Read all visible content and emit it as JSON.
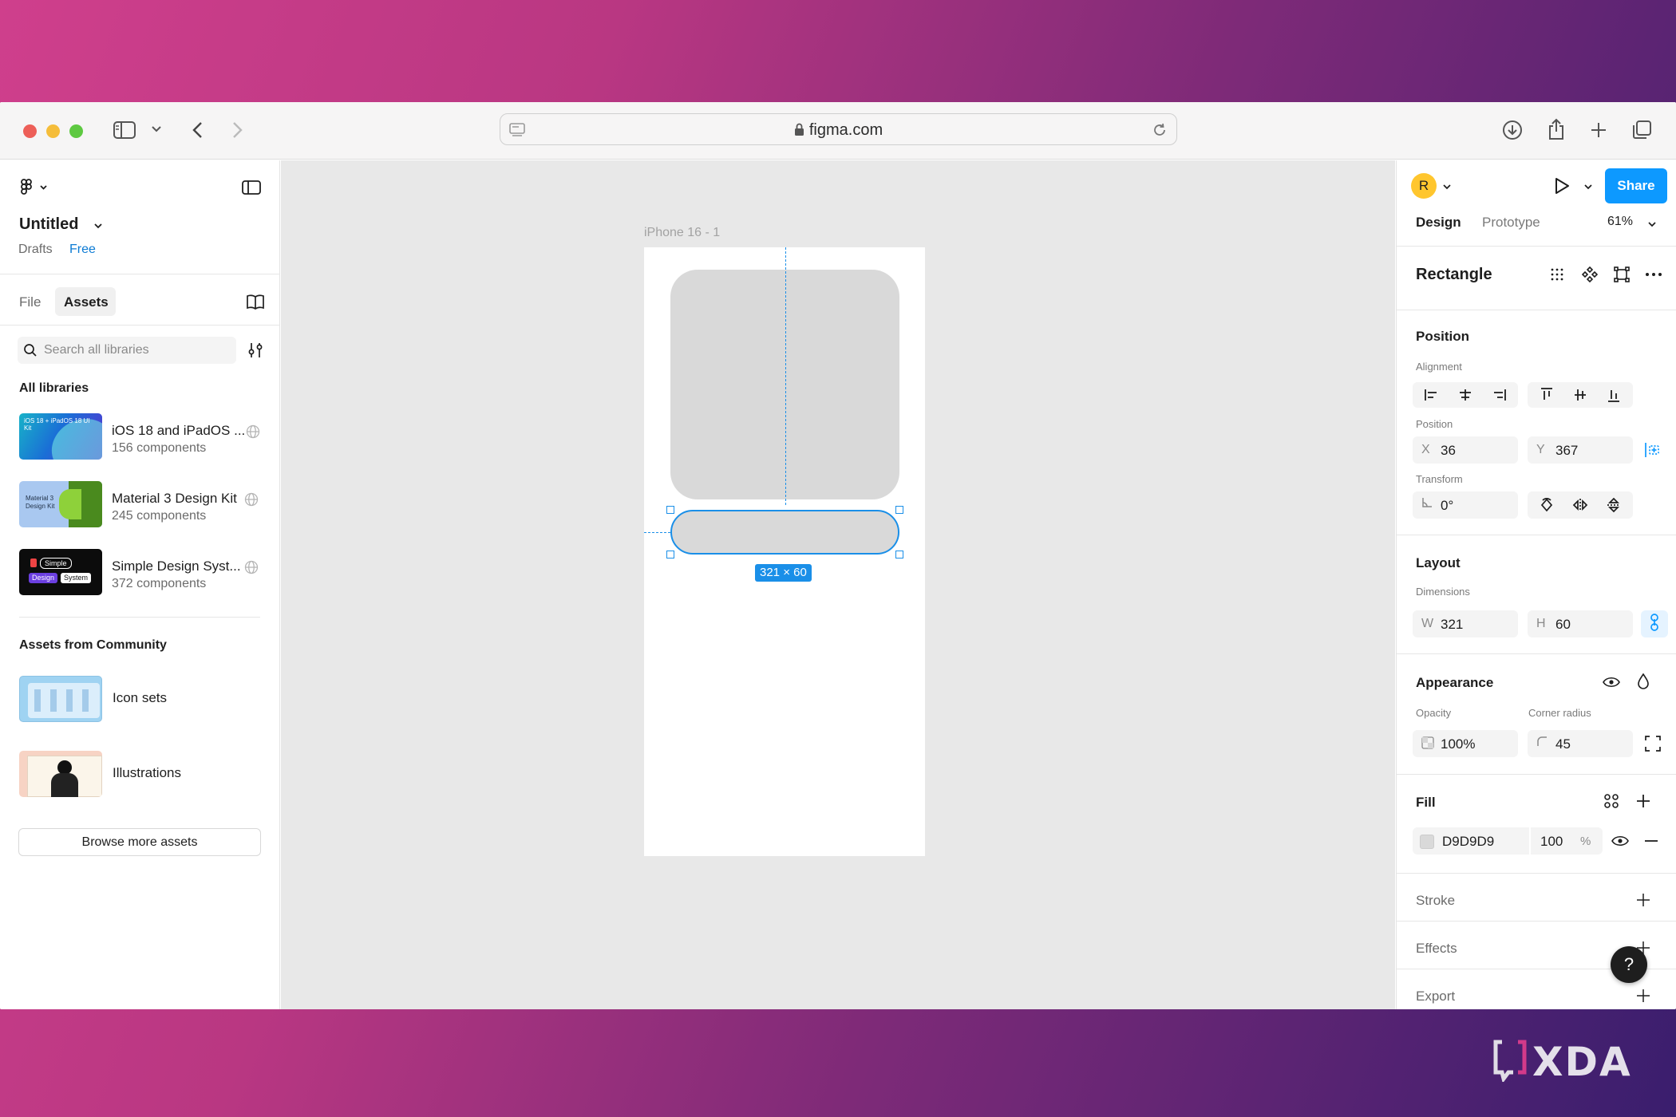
{
  "browser": {
    "url": "figma.com"
  },
  "file": {
    "name": "Untitled",
    "location": "Drafts",
    "plan": "Free"
  },
  "left_panel": {
    "tabs": [
      "File",
      "Assets"
    ],
    "search_placeholder": "Search all libraries",
    "all_libraries_heading": "All libraries",
    "libraries": [
      {
        "name": "iOS 18 and iPadOS ...",
        "count": "156 components",
        "thumb_text": "iOS 18 + iPadOS 18 UI Kit"
      },
      {
        "name": "Material 3 Design Kit",
        "count": "245 components",
        "thumb_text": "Material 3 Design Kit"
      },
      {
        "name": "Simple Design Syst...",
        "count": "372 components",
        "thumb_text_1": "Simple",
        "thumb_text_2": "Design",
        "thumb_text_3": "System"
      }
    ],
    "community_heading": "Assets from Community",
    "community": [
      {
        "name": "Icon sets"
      },
      {
        "name": "Illustrations"
      }
    ],
    "browse_button": "Browse more assets"
  },
  "canvas": {
    "frame_label": "iPhone 16 - 1",
    "dimension_badge": "321 × 60"
  },
  "right_panel": {
    "avatar_initial": "R",
    "share_label": "Share",
    "tabs": [
      "Design",
      "Prototype"
    ],
    "zoom": "61%",
    "selection_title": "Rectangle",
    "position": {
      "heading": "Position",
      "alignment_label": "Alignment",
      "position_label": "Position",
      "x_label": "X",
      "x_value": "36",
      "y_label": "Y",
      "y_value": "367",
      "transform_label": "Transform",
      "rotation_value": "0°"
    },
    "layout": {
      "heading": "Layout",
      "dimensions_label": "Dimensions",
      "w_label": "W",
      "w_value": "321",
      "h_label": "H",
      "h_value": "60"
    },
    "appearance": {
      "heading": "Appearance",
      "opacity_label": "Opacity",
      "opacity_value": "100%",
      "radius_label": "Corner radius",
      "radius_value": "45"
    },
    "fill": {
      "heading": "Fill",
      "hex": "D9D9D9",
      "opacity": "100",
      "percent": "%",
      "swatch_color": "#d9d9d9"
    },
    "stroke_heading": "Stroke",
    "effects_heading": "Effects",
    "export_heading": "Export",
    "help_label": "?"
  },
  "watermark": "XDA",
  "colors": {
    "accent": "#0d99ff",
    "rect_fill": "#d9d9d9"
  }
}
